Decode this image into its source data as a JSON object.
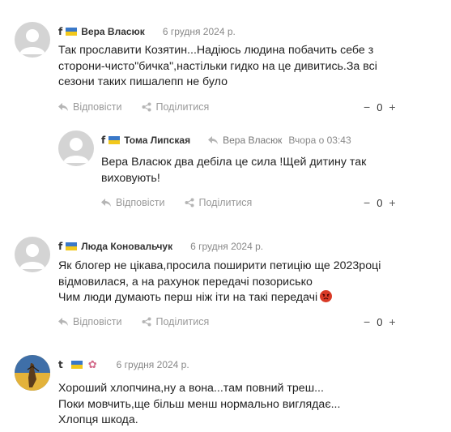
{
  "comments": [
    {
      "network": "f",
      "author": "Вера Власюк",
      "date": "6 грудня 2024 р.",
      "lines": [
        "Так прославити Козятин...Надіюсь людина побачить себе з",
        "сторони-чисто\"бичка\",настільки гидко на це дивитись.За всі",
        "сезони таких пишалепп не було"
      ],
      "reply_label": "Відповісти",
      "share_label": "Поділитися",
      "votes": "0",
      "minus": "−",
      "plus": "+"
    },
    {
      "network": "f",
      "author": "Тома Липская",
      "reply_to": "Вера Власюк",
      "date": "Вчора о 03:43",
      "lines": [
        "Вера Власюк два дебіла це сила !Щей дитину так",
        "виховують!"
      ],
      "reply_label": "Відповісти",
      "share_label": "Поділитися",
      "votes": "0",
      "minus": "−",
      "plus": "+"
    },
    {
      "network": "f",
      "author": "Люда Коновальчук",
      "date": "6 грудня 2024 р.",
      "lines": [
        "Як блогер не цікава,просила поширити петицію ще 2023році",
        "відмовилася, а на рахунок передачі позорисько",
        "Чим люди думають перш ніж іти  на такі передачі"
      ],
      "reply_label": "Відповісти",
      "share_label": "Поділитися",
      "votes": "0",
      "minus": "−",
      "plus": "+"
    },
    {
      "network": "t",
      "author": "",
      "date": "6 грудня 2024 р.",
      "lines": [
        "Хороший хлопчина,ну а вона...там повний треш...",
        "Поки мовчить,ще більш менш нормально виглядає...",
        "Хлопця шкода."
      ]
    }
  ],
  "colors": {
    "flag_blue": "#3a78c8",
    "flag_yellow": "#f2c81c",
    "muted": "#999999",
    "text": "#222222"
  },
  "icons": {
    "reply": "reply-arrow-icon",
    "share": "share-icon",
    "avatar": "default-user-icon",
    "angry": "angry-face-emoji"
  }
}
